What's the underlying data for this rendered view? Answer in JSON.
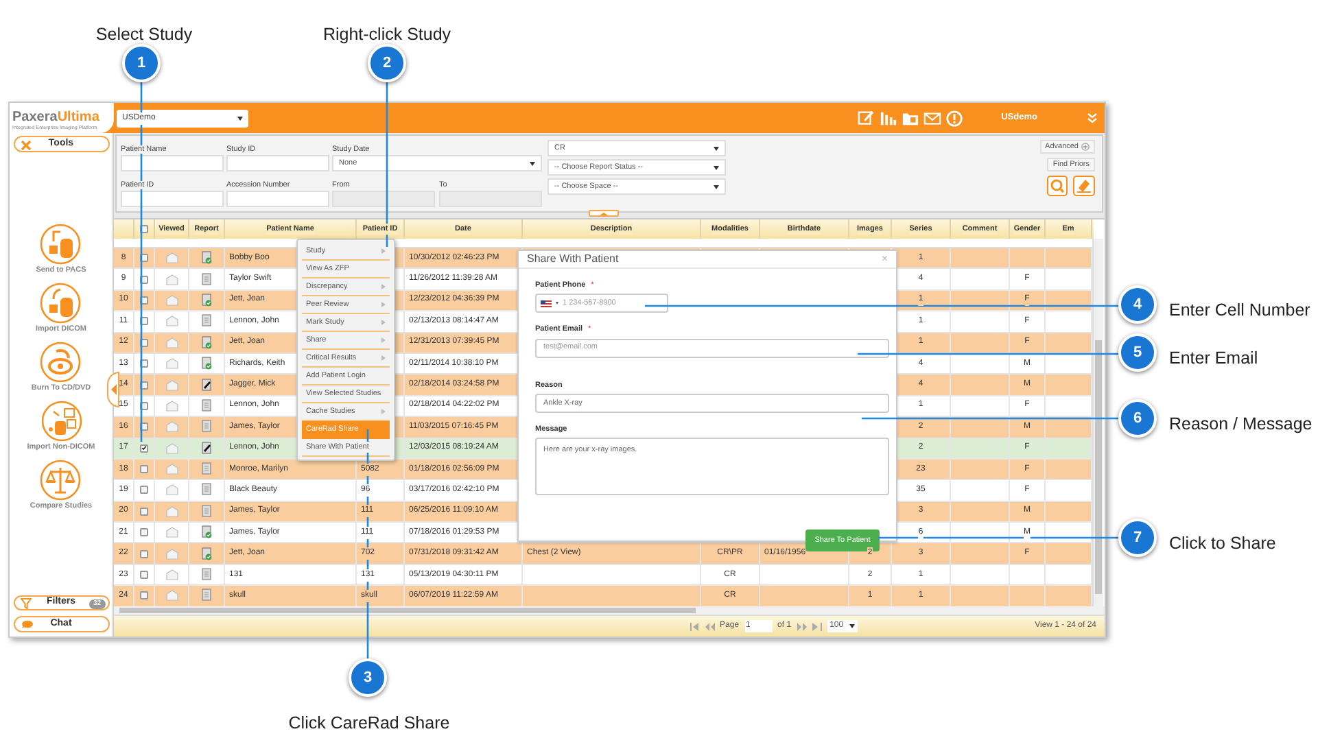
{
  "callouts": [
    {
      "number": "1",
      "label": "Select Study"
    },
    {
      "number": "2",
      "label": "Right-click Study"
    },
    {
      "number": "3",
      "label": "Click CareRad Share"
    },
    {
      "number": "4",
      "label": "Enter Cell Number"
    },
    {
      "number": "5",
      "label": "Enter Email"
    },
    {
      "number": "6",
      "label": "Reason / Message"
    },
    {
      "number": "7",
      "label": "Click to Share"
    }
  ],
  "header": {
    "logo": [
      "Paxera",
      "Ultima"
    ],
    "tagline": "Integrated Enterprise Imaging Platform",
    "workspace": "USDemo",
    "user": "USdemo"
  },
  "sidebar": {
    "tools": "Tools",
    "actions": [
      {
        "label": "Send to PACS"
      },
      {
        "label": "Import DICOM"
      },
      {
        "label": "Burn To CD/DVD"
      },
      {
        "label": "Import Non-DICOM"
      },
      {
        "label": "Compare Studies"
      }
    ],
    "filters": {
      "label": "Filters",
      "count": "32"
    },
    "chat": "Chat"
  },
  "search": {
    "patient_name": {
      "label": "Patient Name"
    },
    "study_id": {
      "label": "Study ID"
    },
    "study_date": {
      "label": "Study Date",
      "value": "None"
    },
    "patient_id": {
      "label": "Patient ID"
    },
    "accession": {
      "label": "Accession Number"
    },
    "from": {
      "label": "From"
    },
    "to": {
      "label": "To"
    },
    "selects": [
      "CR",
      "-- Choose Report Status --",
      "-- Choose Space --"
    ],
    "advanced": "Advanced",
    "find_priors": "Find Priors"
  },
  "grid": {
    "columns": [
      {
        "kind": "number"
      },
      {
        "kind": "select_all",
        "checked": false
      },
      {
        "label": "Viewed"
      },
      {
        "label": "Report"
      },
      {
        "label": "Patient Name"
      },
      {
        "label": "Patient ID"
      },
      {
        "label": "Date"
      },
      {
        "label": "Description"
      },
      {
        "label": "Modalities"
      },
      {
        "label": "Birthdate"
      },
      {
        "label": "Images"
      },
      {
        "label": "Series"
      },
      {
        "label": "Comment"
      },
      {
        "label": "Gender"
      },
      {
        "label": "Em"
      }
    ],
    "rows": [
      {
        "number": "8",
        "checked": false,
        "selected": false,
        "signed": true,
        "draft": false,
        "name": "Bobby Boo",
        "date": "10/30/2012 02:46:23 PM",
        "series": "1"
      },
      {
        "number": "9",
        "checked": false,
        "selected": false,
        "signed": false,
        "draft": false,
        "name": "Taylor Swift",
        "date": "11/26/2012 11:39:28 AM",
        "series": "4",
        "gender": "F"
      },
      {
        "number": "10",
        "checked": false,
        "selected": false,
        "signed": true,
        "draft": false,
        "name": "Jett, Joan",
        "date": "12/23/2012 04:36:39 PM",
        "series": "1",
        "gender": "F"
      },
      {
        "number": "11",
        "checked": false,
        "selected": false,
        "signed": false,
        "draft": false,
        "name": "Lennon, John",
        "date": "02/13/2013 08:14:47 AM",
        "series": "1",
        "gender": "F"
      },
      {
        "number": "12",
        "checked": false,
        "selected": false,
        "signed": true,
        "draft": false,
        "name": "Jett, Joan",
        "date": "12/31/2013 07:39:45 PM",
        "series": "1",
        "gender": "F"
      },
      {
        "number": "13",
        "checked": false,
        "selected": false,
        "signed": true,
        "draft": false,
        "name": "Richards, Keith",
        "date": "02/11/2014 10:38:10 PM",
        "series": "4",
        "gender": "M"
      },
      {
        "number": "14",
        "checked": false,
        "selected": false,
        "signed": false,
        "draft": true,
        "name": "Jagger, Mick",
        "date": "02/18/2014 03:24:58 PM",
        "series": "4",
        "gender": "M"
      },
      {
        "number": "15",
        "checked": false,
        "selected": false,
        "signed": false,
        "draft": false,
        "name": "Lennon, John",
        "date": "02/18/2014 04:22:02 PM",
        "series": "1",
        "gender": "F"
      },
      {
        "number": "16",
        "checked": false,
        "selected": false,
        "signed": false,
        "draft": false,
        "name": "James, Taylor",
        "date": "11/03/2015 07:16:45 PM",
        "series": "2",
        "gender": "M"
      },
      {
        "number": "17",
        "checked": true,
        "selected": true,
        "signed": false,
        "draft": true,
        "name": "Lennon, John",
        "date": "12/03/2015 08:19:24 AM",
        "series": "2",
        "gender": "F"
      },
      {
        "number": "18",
        "checked": false,
        "selected": false,
        "signed": false,
        "draft": false,
        "name": "Monroe, Marilyn",
        "patient_id": "5082",
        "date": "01/18/2016 02:56:09 PM",
        "series": "23",
        "gender": "F"
      },
      {
        "number": "19",
        "checked": false,
        "selected": false,
        "signed": false,
        "draft": false,
        "name": "Black Beauty",
        "patient_id": "96",
        "date": "03/17/2016 02:42:10 PM",
        "series": "35",
        "gender": "F"
      },
      {
        "number": "20",
        "checked": false,
        "selected": false,
        "signed": false,
        "draft": false,
        "name": "James, Taylor",
        "patient_id": "111",
        "date": "06/25/2016 11:09:10 AM",
        "series": "3",
        "gender": "M"
      },
      {
        "number": "21",
        "checked": false,
        "selected": false,
        "signed": true,
        "draft": false,
        "name": "James, Taylor",
        "patient_id": "111",
        "date": "07/18/2016 01:29:53 PM",
        "series": "6",
        "gender": "M"
      },
      {
        "number": "22",
        "checked": false,
        "selected": false,
        "signed": true,
        "draft": false,
        "name": "Jett, Joan",
        "patient_id": "702",
        "date": "07/31/2018 09:31:42 AM",
        "description": "Chest (2 View)",
        "modalities": "CR\\PR",
        "birthdate": "01/16/1956",
        "images": "2",
        "series": "3",
        "gender": "F"
      },
      {
        "number": "23",
        "checked": false,
        "selected": false,
        "signed": false,
        "draft": false,
        "name": "131",
        "patient_id": "131",
        "date": "05/13/2019 04:30:11 PM",
        "modalities": "CR",
        "images": "2",
        "series": "1"
      },
      {
        "number": "24",
        "checked": false,
        "selected": false,
        "signed": false,
        "draft": false,
        "name": "skull",
        "patient_id": "skull",
        "date": "06/07/2019 11:22:59 AM",
        "modalities": "CR",
        "images": "1",
        "series": "1"
      }
    ]
  },
  "pager": {
    "page_label": "Page",
    "page": "1",
    "of": "of 1",
    "page_size": "100",
    "summary": "View 1 - 24 of 24"
  },
  "context_menu": {
    "items": [
      {
        "label": "Study",
        "submenu": true,
        "selected": false
      },
      {
        "label": "View As ZFP",
        "submenu": false,
        "selected": false
      },
      {
        "label": "Discrepancy",
        "submenu": true,
        "selected": false
      },
      {
        "label": "Peer Review",
        "submenu": true,
        "selected": false
      },
      {
        "label": "Mark Study",
        "submenu": true,
        "selected": false
      },
      {
        "label": "Share",
        "submenu": true,
        "selected": false
      },
      {
        "label": "Critical Results",
        "submenu": true,
        "selected": false
      },
      {
        "label": "Add Patient Login",
        "submenu": false,
        "selected": false
      },
      {
        "label": "View Selected Studies",
        "submenu": false,
        "selected": false
      },
      {
        "label": "Cache Studies",
        "submenu": true,
        "selected": false
      },
      {
        "label": "CareRad Share",
        "submenu": false,
        "selected": true
      },
      {
        "label": "Share With Patient",
        "submenu": false,
        "selected": false
      }
    ]
  },
  "dialog": {
    "title": "Share With Patient",
    "close": "×",
    "fields": [
      {
        "kind": "phone",
        "label": "Patient Phone",
        "required_mark": "*",
        "placeholder": "1 234-567-8900"
      },
      {
        "kind": "text",
        "label": "Patient Email",
        "required_mark": "*",
        "placeholder": "test@email.com"
      },
      {
        "kind": "text",
        "label": "Reason",
        "value": "Ankle X-ray"
      },
      {
        "kind": "textarea",
        "label": "Message",
        "value": "Here are your x-ray images."
      }
    ],
    "button": "Share To Patient"
  }
}
